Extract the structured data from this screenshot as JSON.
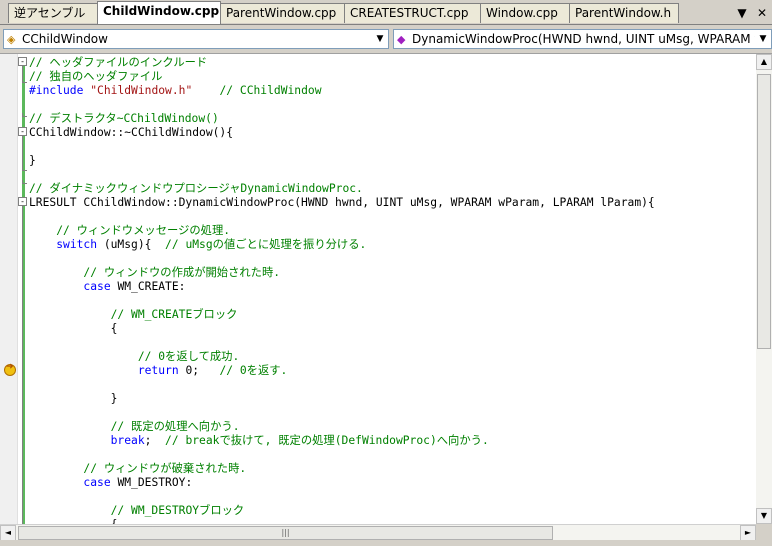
{
  "tabs": [
    {
      "label": "逆アセンブル",
      "active": false
    },
    {
      "label": "ChildWindow.cpp",
      "active": true
    },
    {
      "label": "ParentWindow.cpp",
      "active": false
    },
    {
      "label": "CREATESTRUCT.cpp",
      "active": false
    },
    {
      "label": "Window.cpp",
      "active": false
    },
    {
      "label": "ParentWindow.h",
      "active": false
    }
  ],
  "tab_controls": {
    "dropdown": "▼",
    "close": "✕"
  },
  "nav": {
    "class_combo": {
      "icon": "class-icon",
      "value": "CChildWindow"
    },
    "member_combo": {
      "icon": "method-icon",
      "value": "DynamicWindowProc(HWND hwnd, UINT uMsg, WPARAM w"
    }
  },
  "code_lines": [
    [
      {
        "t": "// ヘッダファイルのインクルード",
        "c": "c"
      }
    ],
    [
      {
        "t": "// 独自のヘッダファイル",
        "c": "c"
      }
    ],
    [
      {
        "t": "#include",
        "c": "k"
      },
      {
        "t": " ",
        "c": "p"
      },
      {
        "t": "\"ChildWindow.h\"",
        "c": "s"
      },
      {
        "t": "    ",
        "c": "p"
      },
      {
        "t": "// CChildWindow",
        "c": "c"
      }
    ],
    [],
    [
      {
        "t": "// デストラクタ~CChildWindow()",
        "c": "c"
      }
    ],
    [
      {
        "t": "CChildWindow::~CChildWindow(){",
        "c": "p"
      }
    ],
    [],
    [
      {
        "t": "}",
        "c": "p"
      }
    ],
    [],
    [
      {
        "t": "// ダイナミックウィンドウプロシージャDynamicWindowProc.",
        "c": "c"
      }
    ],
    [
      {
        "t": "LRESULT CChildWindow::DynamicWindowProc(HWND hwnd, UINT uMsg, WPARAM wParam, LPARAM lParam){",
        "c": "p"
      }
    ],
    [],
    [
      {
        "t": "    ",
        "c": "p"
      },
      {
        "t": "// ウィンドウメッセージの処理.",
        "c": "c"
      }
    ],
    [
      {
        "t": "    ",
        "c": "p"
      },
      {
        "t": "switch",
        "c": "k"
      },
      {
        "t": " (uMsg){  ",
        "c": "p"
      },
      {
        "t": "// uMsgの値ごとに処理を振り分ける.",
        "c": "c"
      }
    ],
    [],
    [
      {
        "t": "        ",
        "c": "p"
      },
      {
        "t": "// ウィンドウの作成が開始された時.",
        "c": "c"
      }
    ],
    [
      {
        "t": "        ",
        "c": "p"
      },
      {
        "t": "case",
        "c": "k"
      },
      {
        "t": " WM_CREATE:",
        "c": "p"
      }
    ],
    [],
    [
      {
        "t": "            ",
        "c": "p"
      },
      {
        "t": "// WM_CREATEブロック",
        "c": "c"
      }
    ],
    [
      {
        "t": "            {",
        "c": "p"
      }
    ],
    [],
    [
      {
        "t": "                ",
        "c": "p"
      },
      {
        "t": "// 0を返して成功.",
        "c": "c"
      }
    ],
    [
      {
        "t": "                ",
        "c": "p"
      },
      {
        "t": "return",
        "c": "k"
      },
      {
        "t": " 0;   ",
        "c": "p"
      },
      {
        "t": "// 0を返す.",
        "c": "c"
      }
    ],
    [],
    [
      {
        "t": "            }",
        "c": "p"
      }
    ],
    [],
    [
      {
        "t": "            ",
        "c": "p"
      },
      {
        "t": "// 既定の処理へ向かう.",
        "c": "c"
      }
    ],
    [
      {
        "t": "            ",
        "c": "p"
      },
      {
        "t": "break",
        "c": "k"
      },
      {
        "t": ";  ",
        "c": "p"
      },
      {
        "t": "// breakで抜けて, 既定の処理(DefWindowProc)へ向かう.",
        "c": "c"
      }
    ],
    [],
    [
      {
        "t": "        ",
        "c": "p"
      },
      {
        "t": "// ウィンドウが破棄された時.",
        "c": "c"
      }
    ],
    [
      {
        "t": "        ",
        "c": "p"
      },
      {
        "t": "case",
        "c": "k"
      },
      {
        "t": " WM_DESTROY:",
        "c": "p"
      }
    ],
    [],
    [
      {
        "t": "            ",
        "c": "p"
      },
      {
        "t": "// WM_DESTROYブロック",
        "c": "c"
      }
    ],
    [
      {
        "t": "            {",
        "c": "p"
      }
    ]
  ],
  "breakpoint_line": 22,
  "scroll": {
    "up": "▲",
    "down": "▼",
    "left": "◄",
    "right": "►",
    "grip": "|||"
  }
}
